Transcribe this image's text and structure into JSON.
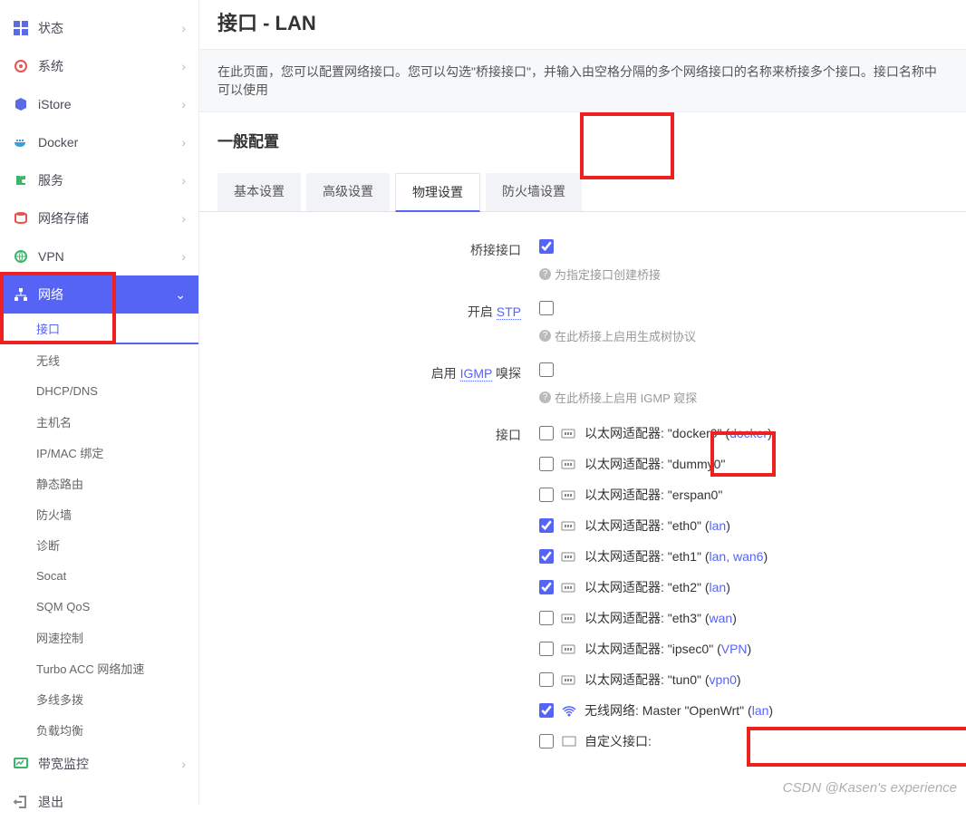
{
  "sidebar": {
    "status": "状态",
    "system": "系统",
    "istore": "iStore",
    "docker": "Docker",
    "service": "服务",
    "nas": "网络存储",
    "vpn": "VPN",
    "network": "网络",
    "network_items": {
      "interface": "接口",
      "wireless": "无线",
      "dhcp": "DHCP/DNS",
      "hostname": "主机名",
      "ipmac": "IP/MAC 绑定",
      "staticroute": "静态路由",
      "firewall": "防火墙",
      "diag": "诊断",
      "socat": "Socat",
      "sqm": "SQM QoS",
      "speedlimit": "网速控制",
      "turbo": "Turbo ACC 网络加速",
      "mwan": "多线多拨",
      "loadbalance": "负载均衡"
    },
    "bandwidth": "带宽监控",
    "logout": "退出"
  },
  "page": {
    "title": "接口 - LAN",
    "desc": "在此页面，您可以配置网络接口。您可以勾选\"桥接接口\"，并输入由空格分隔的多个网络接口的名称来桥接多个接口。接口名称中可以使用",
    "section": "一般配置"
  },
  "tabs": {
    "basic": "基本设置",
    "advanced": "高级设置",
    "physical": "物理设置",
    "firewall": "防火墙设置"
  },
  "form": {
    "bridge_label": "桥接接口",
    "bridge_help": "为指定接口创建桥接",
    "stp_label_prefix": "开启 ",
    "stp_link": "STP",
    "stp_help": "在此桥接上启用生成树协议",
    "igmp_label_prefix": "启用 ",
    "igmp_link": "IGMP",
    "igmp_label_suffix": " 嗅探",
    "igmp_help": "在此桥接上启用 IGMP 窥探",
    "iface_label": "接口"
  },
  "interfaces": [
    {
      "type": "eth",
      "label_prefix": "以太网适配器: \"docker0\" (",
      "link": "docker",
      "label_suffix": ")",
      "checked": false
    },
    {
      "type": "eth",
      "label_prefix": "以太网适配器: \"dummy0\"",
      "link": "",
      "label_suffix": "",
      "checked": false
    },
    {
      "type": "eth",
      "label_prefix": "以太网适配器: \"erspan0\"",
      "link": "",
      "label_suffix": "",
      "checked": false
    },
    {
      "type": "eth",
      "label_prefix": "以太网适配器: \"eth0\" (",
      "link": "lan",
      "label_suffix": ")",
      "checked": true
    },
    {
      "type": "eth",
      "label_prefix": "以太网适配器: \"eth1\" (",
      "link": "lan, wan6",
      "label_suffix": ")",
      "checked": true
    },
    {
      "type": "eth",
      "label_prefix": "以太网适配器: \"eth2\" (",
      "link": "lan",
      "label_suffix": ")",
      "checked": true
    },
    {
      "type": "eth",
      "label_prefix": "以太网适配器: \"eth3\" (",
      "link": "wan",
      "label_suffix": ")",
      "checked": false
    },
    {
      "type": "eth",
      "label_prefix": "以太网适配器: \"ipsec0\" (",
      "link": "VPN",
      "label_suffix": ")",
      "checked": false
    },
    {
      "type": "eth",
      "label_prefix": "以太网适配器: \"tun0\" (",
      "link": "vpn0",
      "label_suffix": ")",
      "checked": false
    },
    {
      "type": "wifi",
      "label_prefix": "无线网络: Master \"OpenWrt\" (",
      "link": "lan",
      "label_suffix": ")",
      "checked": true
    },
    {
      "type": "custom",
      "label_prefix": "自定义接口:",
      "link": "",
      "label_suffix": "",
      "checked": false
    }
  ],
  "watermark": "CSDN @Kasen's experience"
}
